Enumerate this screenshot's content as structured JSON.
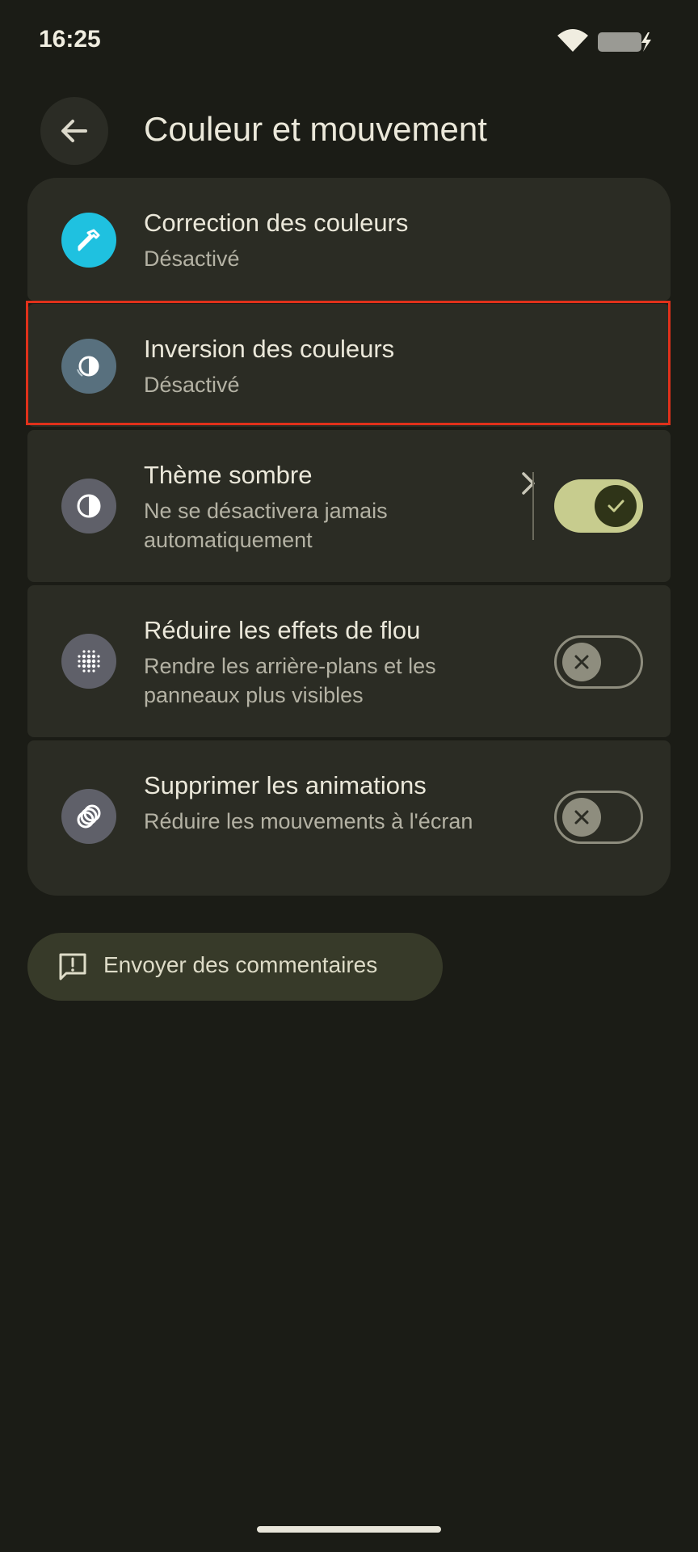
{
  "status_bar": {
    "time": "16:25",
    "icons": [
      "wifi-icon",
      "battery-charging-icon"
    ]
  },
  "header": {
    "back_icon": "arrow-left-icon",
    "title": "Couleur et mouvement"
  },
  "settings": [
    {
      "title": "Correction des couleurs",
      "summary": "Désactivé",
      "icon": "eyedropper-icon",
      "icon_color": "#1fc1e0"
    },
    {
      "title": "Inversion des couleurs",
      "summary": "Désactivé",
      "icon": "color-inversion-icon",
      "icon_color": "#58707e",
      "highlighted": true
    },
    {
      "title": "Thème sombre",
      "summary": "Ne se désactivera jamais automatiquement",
      "icon": "dark-theme-icon",
      "icon_color": "#5f6069",
      "has_chevron": true,
      "toggle_on": true
    },
    {
      "title": "Réduire les effets de flou",
      "summary": "Rendre les arrière-plans et les panneaux plus visibles",
      "icon": "blur-dots-icon",
      "icon_color": "#5f6069",
      "toggle_on": false
    },
    {
      "title": "Supprimer les animations",
      "summary": "Réduire les mouvements à l'écran",
      "icon": "animation-rings-icon",
      "icon_color": "#5f6069",
      "toggle_on": false
    }
  ],
  "feedback": {
    "label": "Envoyer des commentaires",
    "icon": "feedback-icon"
  },
  "colors": {
    "background": "#1b1c16",
    "card": "#2b2c24",
    "toggle_on": "#c7cc8e",
    "highlight": "#e0311b"
  }
}
